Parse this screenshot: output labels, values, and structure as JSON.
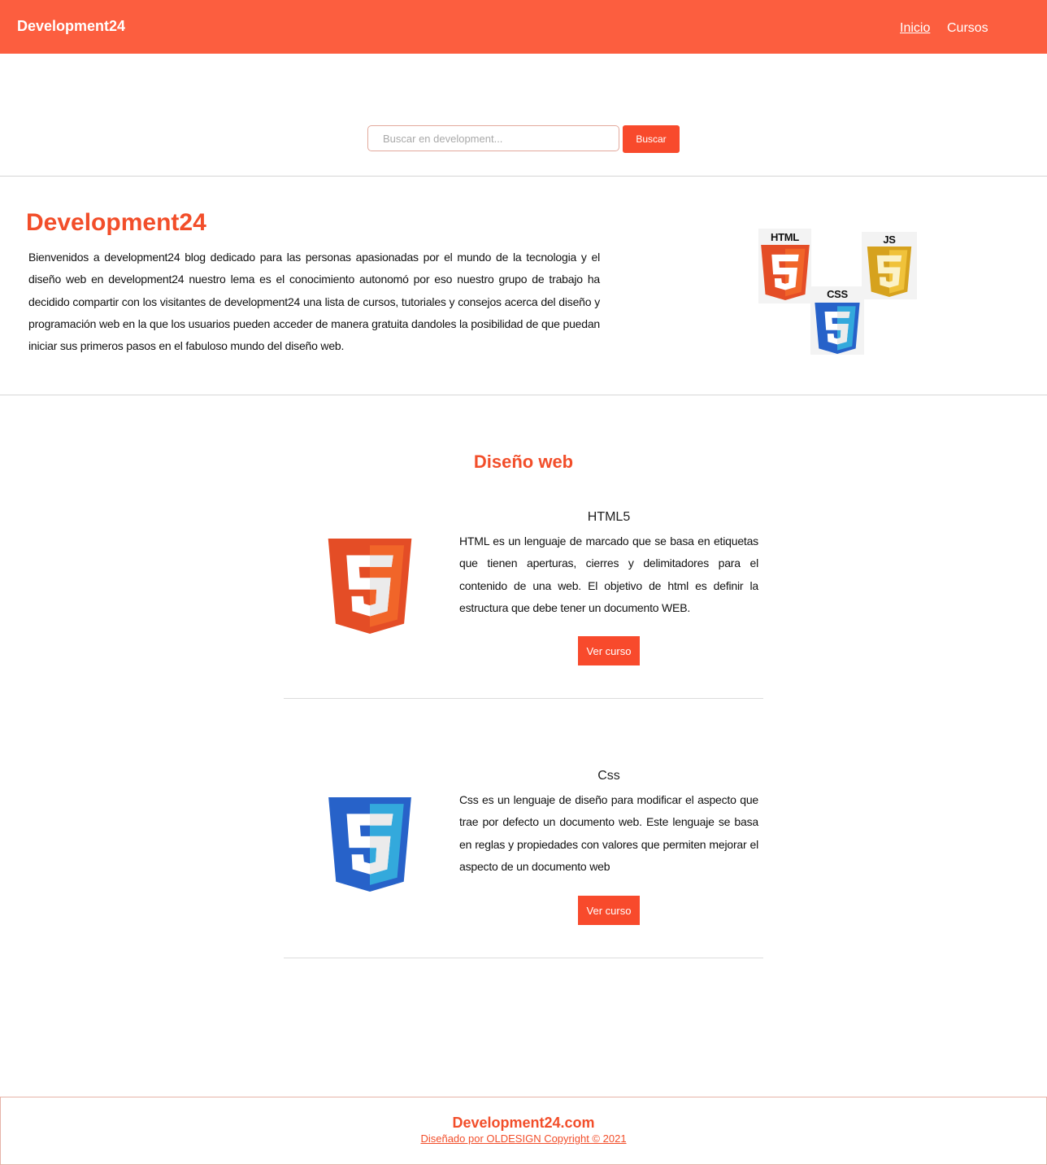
{
  "colors": {
    "brand": "#fc5e3f",
    "accent": "#f24e2a",
    "button": "#f84a2c",
    "html5": "#e44d26",
    "css3": "#2965f1",
    "js": "#f0db4f"
  },
  "navbar": {
    "brand": "Development24",
    "links": [
      {
        "label": "Inicio"
      },
      {
        "label": "Cursos"
      }
    ]
  },
  "search": {
    "placeholder": "Buscar en development...",
    "button_label": "Buscar"
  },
  "hero": {
    "title": "Development24",
    "text": "Bienvenidos a development24 blog dedicado para las personas apasionadas por el mundo de la tecnologia y el diseño web en development24 nuestro lema es el conocimiento autonomó por eso nuestro grupo de trabajo ha decidido compartir con los visitantes de development24 una lista de cursos, tutoriales y consejos acerca del diseño y programación web en la que los usuarios pueden acceder de manera gratuita dandoles la posibilidad de que puedan iniciar sus primeros pasos en el fabuloso mundo del diseño web.",
    "logos": [
      {
        "label": "HTML",
        "icon": "html5-icon"
      },
      {
        "label": "JS",
        "icon": "js-icon"
      },
      {
        "label": "CSS",
        "icon": "css3-icon"
      }
    ]
  },
  "section": {
    "title": "Diseño web"
  },
  "courses": [
    {
      "title": "HTML5",
      "icon": "html5-icon",
      "description": "HTML es un lenguaje de marcado que se basa en etiquetas que tienen aperturas, cierres y delimitadores para el contenido de una web. El objetivo de html es definir la estructura que debe tener un documento WEB.",
      "button_label": "Ver curso"
    },
    {
      "title": "Css",
      "icon": "css3-icon",
      "description": "Css es un lenguaje de diseño para modificar el aspecto que trae por defecto un documento web. Este lenguaje se basa en reglas y propiedades con valores que permiten mejorar el aspecto de un documento web",
      "button_label": "Ver curso"
    }
  ],
  "footer": {
    "title": "Development24.com",
    "credit": "Diseñado por OLDESIGN Copyright © 2021"
  }
}
